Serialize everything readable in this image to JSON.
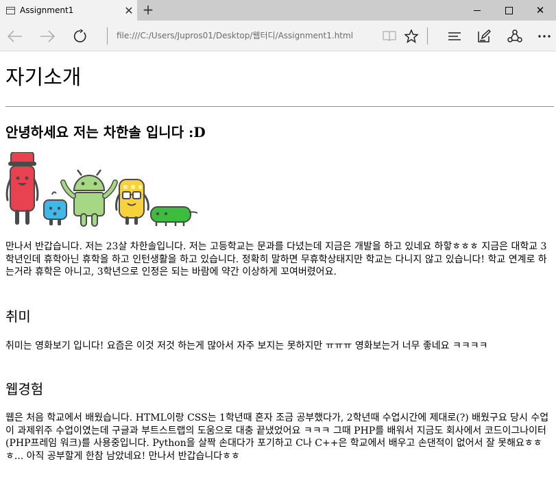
{
  "browser": {
    "tab_title": "Assignment1",
    "new_tab_label": "+",
    "url": "file:///C:/Users/Jupros01/Desktop/웹터디/Assignment1.html"
  },
  "page": {
    "heading": "자기소개",
    "greeting": "안녕하세요 저는 차한솔 입니다 :D",
    "intro": "만나서 반갑습니다. 저는 23살 차한솔입니다. 저는 고등학교는 문과를 다녔는데 지금은 개발을 하고 있네요 하핳ㅎㅎㅎ 지금은 대학교 3학년인데 휴학아닌 휴학을 하고 인턴생활을 하고 있습니다. 정확히 말하면 무휴학상태지만 학교는 다니지 않고 있습니다! 학교 연계로 하는거라 휴학은 아니고, 3학년으로 인정은 되는 바람에 약간 이상하게 꼬여버렸어요.",
    "hobby_heading": "취미",
    "hobby_text": "취미는 영화보기 입니다! 요즘은 이것 저것 하는게 많아서 자주 보지는 못하지만 ㅠㅠㅠ 영화보는거 너무 좋네요 ㅋㅋㅋㅋ",
    "web_heading": "웹경험",
    "web_text": "웹은 처음 학교에서 배웠습니다. HTML이랑 CSS는 1학년때 혼자 조금 공부했다가, 2학년때 수업시간에 제대로(?) 배웠구요 당시 수업이 과제위주 수업이였는데 구글과 부트스트랩의 도움으로 대충 끝냈었어요 ㅋㅋㅋ 그때 PHP를 배워서 지금도 회사에서 코드이그나이터(PHP프레임 워크)를 사용중입니다. Python을 살짝 손대다가 포기하고 C나 C++은 학교에서 배우고 손댄적이 없어서 잘 못해요ㅎㅎㅎ... 아직 공부할게 한참 남았네요! 만나서 반갑습니다ㅎㅎ"
  },
  "colors": {
    "red_robot": "#e8414f",
    "blue_robot": "#3fb8e8",
    "android": "#a6d785",
    "yellow_robot": "#f7d23a",
    "green_bug": "#3dbd3d",
    "outline": "#4a4a4a"
  },
  "icons": [
    "page-icon",
    "close-icon",
    "minimize-icon",
    "maximize-icon",
    "back-icon",
    "forward-icon",
    "refresh-icon",
    "reading-view-icon",
    "favorite-star-icon",
    "hub-icon",
    "web-note-icon",
    "share-icon",
    "more-icon"
  ]
}
